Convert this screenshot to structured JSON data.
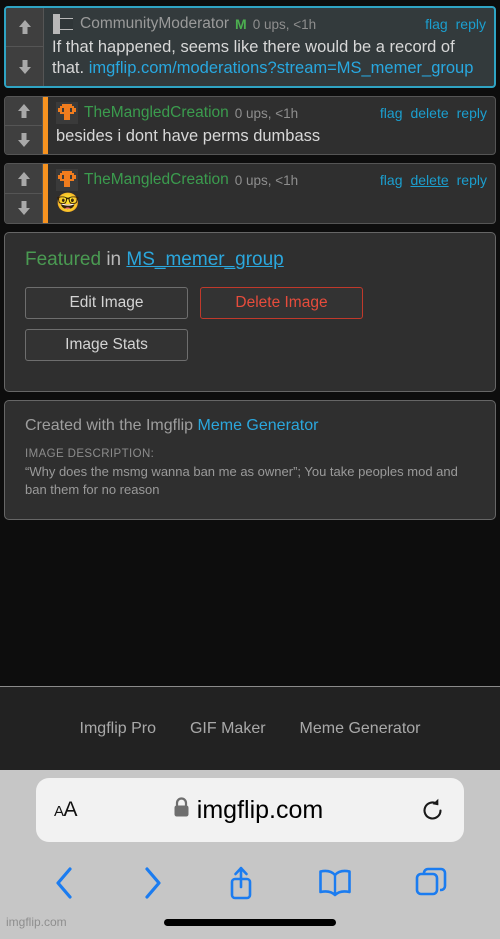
{
  "comments": [
    {
      "highlighted": true,
      "avatar": "c-letter-avatar",
      "username": "CommunityModerator",
      "username_color": "grey",
      "badge": "M",
      "meta": "0 ups, <1h",
      "actions": [
        {
          "label": "flag",
          "underline": false
        },
        {
          "label": "reply",
          "underline": false
        }
      ],
      "text_before": "If that happened, seems like there would be a record of that. ",
      "link": "imgflip.com/moderations?stream=MS_memer_group",
      "emoji": ""
    },
    {
      "highlighted": false,
      "avatar": "pixel-orange-avatar",
      "username": "TheMangledCreation",
      "username_color": "green",
      "badge": "",
      "meta": "0 ups, <1h",
      "actions": [
        {
          "label": "flag",
          "underline": false
        },
        {
          "label": "delete",
          "underline": false
        },
        {
          "label": "reply",
          "underline": false
        }
      ],
      "text_before": "besides i dont have perms dumbass",
      "link": "",
      "emoji": ""
    },
    {
      "highlighted": false,
      "avatar": "pixel-orange-avatar",
      "username": "TheMangledCreation",
      "username_color": "green",
      "badge": "",
      "meta": "0 ups, <1h",
      "actions": [
        {
          "label": "flag",
          "underline": false
        },
        {
          "label": "delete",
          "underline": true
        },
        {
          "label": "reply",
          "underline": false
        }
      ],
      "text_before": "",
      "link": "",
      "emoji": "🤓"
    }
  ],
  "featured": {
    "status": "Featured",
    "in_word": "in",
    "stream": "MS_memer_group",
    "edit_label": "Edit Image",
    "delete_label": "Delete Image",
    "stats_label": "Image Stats"
  },
  "created": {
    "prefix": "Created with the Imgflip ",
    "link": "Meme Generator",
    "description_label": "IMAGE DESCRIPTION:",
    "description_text": "“Why does the msmg wanna ban me as owner”; You take peoples mod and ban them for no reason"
  },
  "site_footer": {
    "links": [
      "Imgflip Pro",
      "GIF Maker",
      "Meme Generator"
    ]
  },
  "browser": {
    "text_size_small": "A",
    "text_size_large": "A",
    "url": "imgflip.com",
    "watermark": "imgflip.com"
  },
  "colors": {
    "accent_orange": "#f79320",
    "link_blue": "#28a8e0",
    "highlight_border": "#2fa4c4",
    "green_user": "#3b9c4e",
    "danger_red": "#e74c3c",
    "ios_blue": "#1b7cf0"
  }
}
